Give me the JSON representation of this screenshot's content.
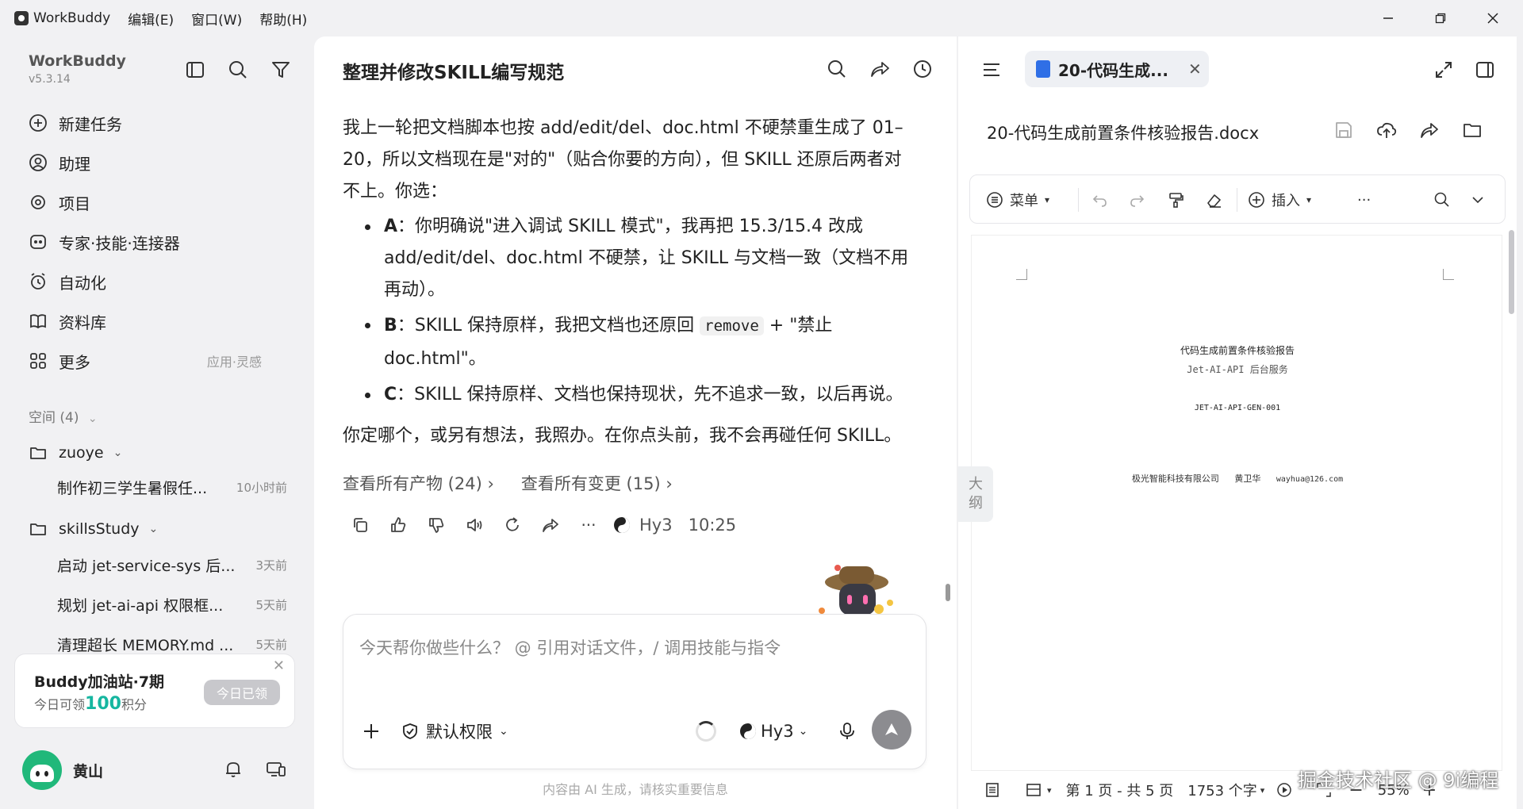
{
  "titlebar": {
    "app_name": "WorkBuddy",
    "menus": [
      "编辑(E)",
      "窗口(W)",
      "帮助(H)"
    ]
  },
  "sidebar": {
    "brand": "WorkBuddy",
    "version": "v5.3.14",
    "nav": [
      {
        "label": "新建任务",
        "icon": "plus-circle-icon"
      },
      {
        "label": "助理",
        "icon": "assistant-icon"
      },
      {
        "label": "项目",
        "icon": "project-icon"
      },
      {
        "label": "专家·技能·连接器",
        "icon": "expert-icon"
      },
      {
        "label": "自动化",
        "icon": "alarm-icon"
      },
      {
        "label": "资料库",
        "icon": "book-icon"
      },
      {
        "label": "更多",
        "icon": "grid-icon",
        "sub": "应用·灵感"
      }
    ],
    "space_header": "空间 (4)",
    "folders": [
      {
        "name": "zuoye",
        "tasks": [
          {
            "title": "制作初三学生暑假任...",
            "time": "10小时前"
          }
        ]
      },
      {
        "name": "skillsStudy",
        "tasks": [
          {
            "title": "启动 jet-service-sys 后...",
            "time": "3天前"
          },
          {
            "title": "规划 jet-ai-api 权限框...",
            "time": "5天前"
          },
          {
            "title": "清理超长 MEMORY.md ...",
            "time": "5天前"
          }
        ]
      }
    ],
    "promo": {
      "title": "Buddy加油站·7期",
      "sub_prefix": "今日可领",
      "points": "100",
      "sub_suffix": "积分",
      "button": "今日已领"
    },
    "user": {
      "name": "黄山"
    }
  },
  "chat": {
    "title": "整理并修改SKILL编写规范",
    "intro": "我上一轮把文档脚本也按 add/edit/del、doc.html 不硬禁重生成了 01–20，所以文档现在是\"对的\"（贴合你要的方向），但 SKILL 还原后两者对不上。你选：",
    "options": [
      {
        "key": "A",
        "text": "：你明确说\"进入调试 SKILL 模式\"，我再把 15.3/15.4 改成 add/edit/del、doc.html 不硬禁，让 SKILL 与文档一致（文档不用再动）。"
      },
      {
        "key": "B",
        "text_before": "：SKILL 保持原样，我把文档也还原回 ",
        "code": "remove",
        "text_after": " + \"禁止 doc.html\"。"
      },
      {
        "key": "C",
        "text": "：SKILL 保持原样、文档也保持现状，先不追求一致，以后再说。"
      }
    ],
    "outro": "你定哪个，或另有想法，我照办。在你点头前，我不会再碰任何 SKILL。",
    "links": [
      "查看所有产物 (24)",
      "查看所有变更 (15)"
    ],
    "model": "Hy3",
    "time": "10:25",
    "input_placeholder": "今天帮你做些什么？ @ 引用对话文件，/ 调用技能与指令",
    "permission": "默认权限",
    "model_selector": "Hy3",
    "disclaimer": "内容由 AI 生成，请核实重要信息"
  },
  "doc": {
    "tab_name": "20-代码生成...",
    "filename": "20-代码生成前置条件核验报告.docx",
    "toolbar": {
      "menu": "菜单",
      "insert": "插入"
    },
    "outline": [
      "大",
      "纲"
    ],
    "page": {
      "title": "代码生成前置条件核验报告",
      "subtitle": "Jet-AI-API 后台服务",
      "code": "JET-AI-API-GEN-001",
      "company": "极光智能科技有限公司",
      "author": "黄卫华",
      "email": "wayhua@126.com"
    },
    "status": {
      "pages": "第 1 页 - 共 5 页",
      "words": "1753 个字",
      "zoom": "55%"
    },
    "watermark": "掘金技术社区 @ 9i编程"
  }
}
